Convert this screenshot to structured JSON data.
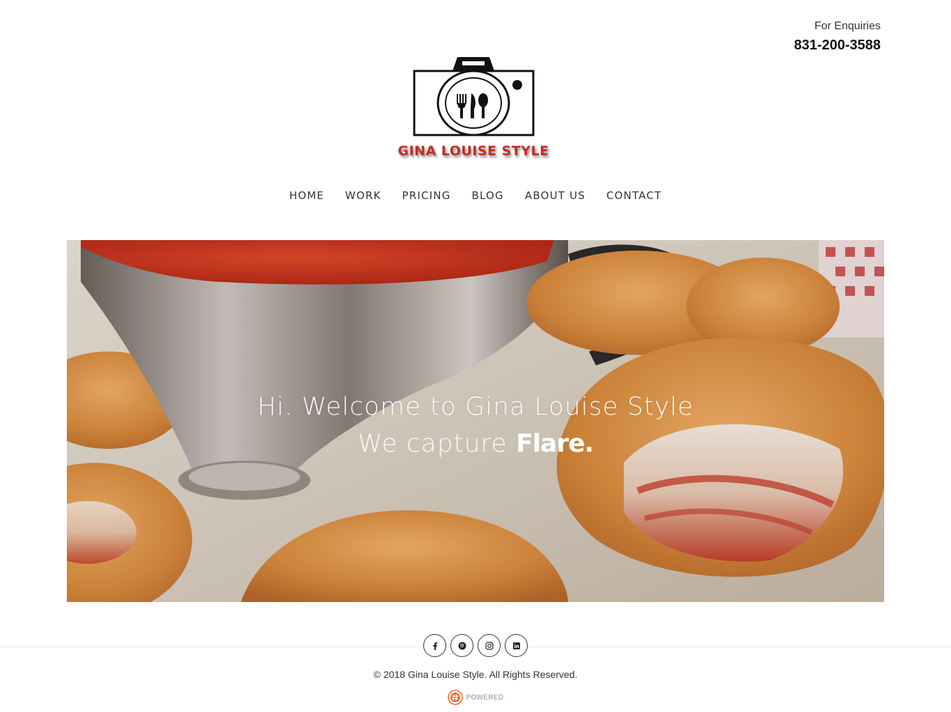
{
  "header": {
    "enquiry_label": "For Enquiries",
    "phone": "831-200-3588"
  },
  "brand": {
    "logo_text": "GINA LOUISE STYLE",
    "logo_color": "#c62a22"
  },
  "nav": {
    "items": [
      {
        "label": "HOME"
      },
      {
        "label": "WORK"
      },
      {
        "label": "PRICING"
      },
      {
        "label": "BLOG"
      },
      {
        "label": "ABOUT US"
      },
      {
        "label": "CONTACT"
      }
    ]
  },
  "hero": {
    "line1": "Hi. Welcome to Gina Louise Style",
    "line2_prefix": "We capture",
    "line2_bold": "Flare."
  },
  "footer": {
    "social": [
      {
        "icon": "facebook-icon"
      },
      {
        "icon": "pinterest-icon"
      },
      {
        "icon": "instagram-icon"
      },
      {
        "icon": "linkedin-icon"
      }
    ],
    "copyright": "© 2018 Gina Louise Style. All Rights Reserved.",
    "powered_label": "POWERED",
    "powered_color": "#f26b2a"
  }
}
